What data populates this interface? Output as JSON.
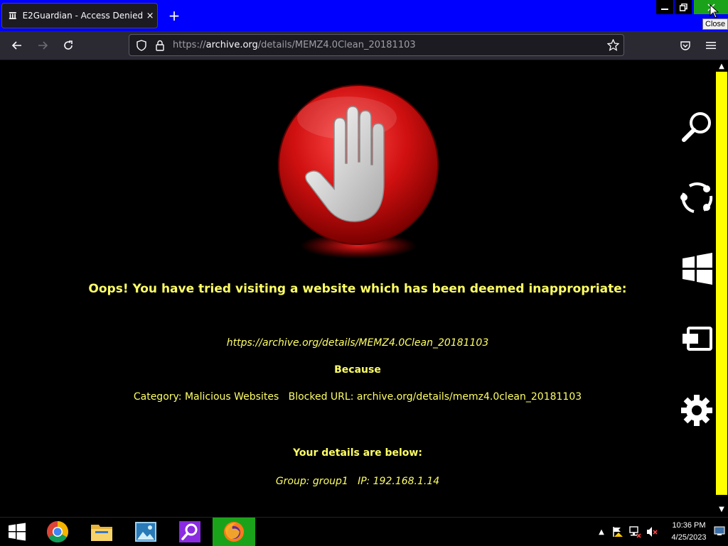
{
  "window": {
    "tab_title": "E2Guardian - Access Denied",
    "tab_close_glyph": "×",
    "new_tab_glyph": "+",
    "close_tooltip": "Close"
  },
  "navbar": {
    "url_prefix": "https://",
    "url_host": "archive.org",
    "url_path": "/details/MEMZ4.0Clean_20181103"
  },
  "page": {
    "heading": "Oops! You have tried visiting a website which has been deemed inappropriate:",
    "blocked_url": "https://archive.org/details/MEMZ4.0Clean_20181103",
    "because": "Because",
    "category_line": "Category: Malicious Websites   Blocked URL: archive.org/details/memz4.0clean_20181103",
    "details_heading": "Your details are below:",
    "group_line": "Group: group1   IP: 192.168.1.14"
  },
  "charms": [
    "search-icon",
    "share-icon",
    "start-icon",
    "devices-icon",
    "settings-icon"
  ],
  "taskbar": {
    "apps": [
      "chrome",
      "file-explorer",
      "photos",
      "search-app",
      "firefox"
    ],
    "active_app": "firefox",
    "time": "10:36 PM",
    "date": "4/25/2023"
  },
  "colors": {
    "titlebar": "#0000ff",
    "text_accent": "#ffff66",
    "scroll_thumb": "#ffff00",
    "active_green": "#1aa31a"
  }
}
